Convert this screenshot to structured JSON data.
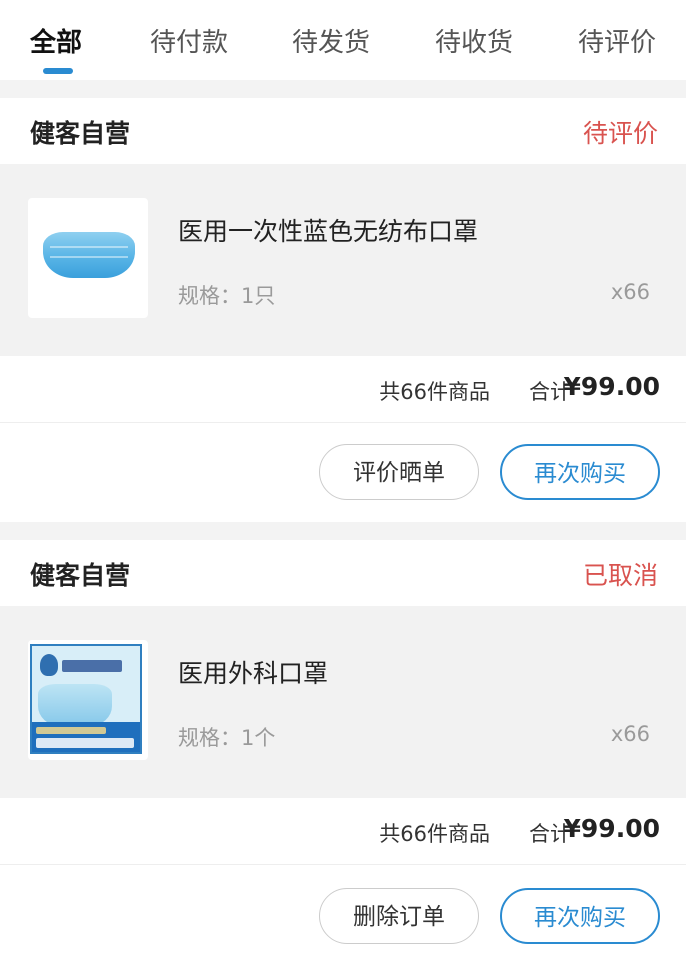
{
  "tabs": [
    {
      "label": "全部",
      "active": true
    },
    {
      "label": "待付款",
      "active": false
    },
    {
      "label": "待发货",
      "active": false
    },
    {
      "label": "待收货",
      "active": false
    },
    {
      "label": "待评价",
      "active": false
    }
  ],
  "orders": [
    {
      "store": "健客自营",
      "status": "待评价",
      "product": {
        "name": "医用一次性蓝色无纺布口罩",
        "spec": "规格：1只",
        "qty": "x66",
        "image": "blue-disposable-mask"
      },
      "count_text": "共66件商品",
      "total_label": "合计",
      "total_value": "¥99.00",
      "buttons": [
        "评价晒单",
        "再次购买"
      ]
    },
    {
      "store": "健客自营",
      "status": "已取消",
      "product": {
        "name": "医用外科口罩",
        "spec": "规格：1个",
        "qty": "x66",
        "image": "surgical-mask-package"
      },
      "count_text": "共66件商品",
      "total_label": "合计",
      "total_value": "¥99.00",
      "buttons": [
        "删除订单",
        "再次购买"
      ]
    }
  ],
  "colors": {
    "accent": "#2a8bd1",
    "status": "#d9534f",
    "background": "#f3f3f3"
  }
}
